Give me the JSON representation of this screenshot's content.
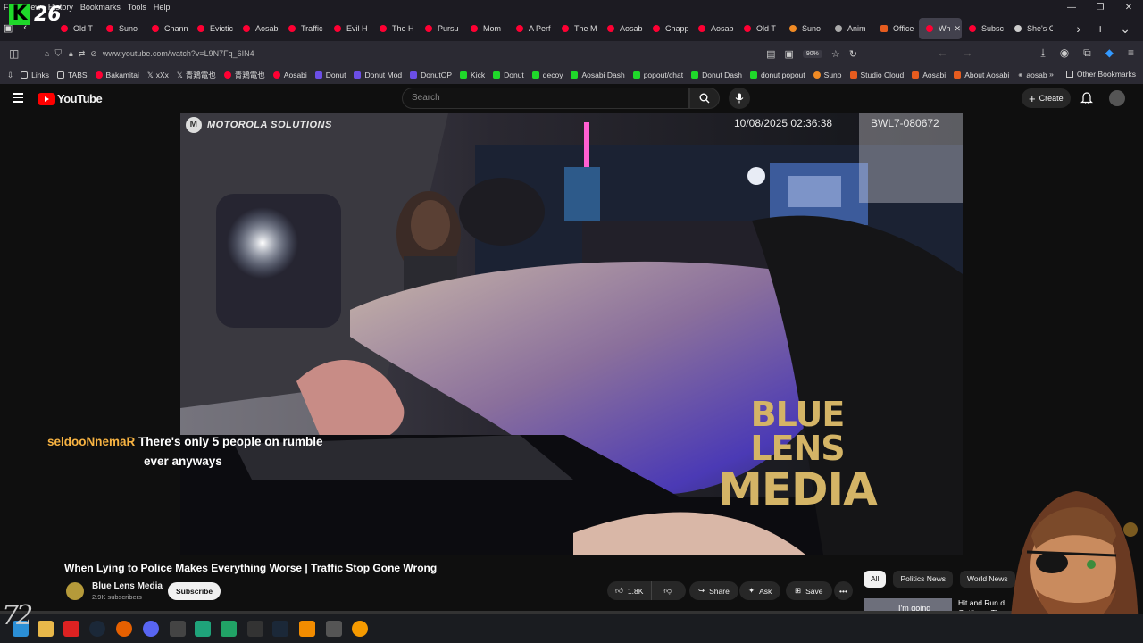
{
  "browser": {
    "menu": [
      "File",
      "View",
      "History",
      "Bookmarks",
      "Tools",
      "Help"
    ],
    "overlay_logo_number": "26",
    "tabs": [
      {
        "label": "Old T"
      },
      {
        "label": "Suno"
      },
      {
        "label": "Chann"
      },
      {
        "label": "Evictic"
      },
      {
        "label": "Aosab"
      },
      {
        "label": "Traffic"
      },
      {
        "label": "Evil H"
      },
      {
        "label": "The H"
      },
      {
        "label": "Pursu"
      },
      {
        "label": "Mom"
      },
      {
        "label": "A Perf"
      },
      {
        "label": "The M"
      },
      {
        "label": "Aosab"
      },
      {
        "label": "Chapp"
      },
      {
        "label": "Aosab"
      },
      {
        "label": "Old T"
      },
      {
        "label": "Suno"
      },
      {
        "label": "Anim"
      },
      {
        "label": "Office"
      },
      {
        "label": "Wh",
        "active": true
      },
      {
        "label": "Subsc"
      },
      {
        "label": "She's C"
      }
    ],
    "url": "www.youtube.com/watch?v=L9N7Fq_6IN4",
    "zoom": "90%",
    "bookmarks": [
      "Links",
      "TABS",
      "Bakamitai",
      "xXx",
      "青鶏電也",
      "青鶏電也",
      "Aosabi",
      "Donut",
      "Donut Mod",
      "DonutOP",
      "Kick",
      "Donut",
      "decoy",
      "Aosabi Dash",
      "popout/chat",
      "Donut Dash",
      "donut popout",
      "Suno",
      "Studio Cloud",
      "Aosabi",
      "About Aosabi",
      "aosab"
    ],
    "other_bookmarks": "Other Bookmarks"
  },
  "youtube": {
    "logo_text": "YouTube",
    "search_placeholder": "Search",
    "create_label": "Create",
    "video": {
      "camera_brand": "MOTOROLA SOLUTIONS",
      "timestamp": "10/08/2025 02:36:38",
      "device_id": "BWL7-080672",
      "watermark_line1": "BLUE LENS",
      "watermark_line2": "MEDIA"
    },
    "title": "When Lying to Police Makes Everything Worse | Traffic Stop Gone Wrong",
    "channel": {
      "name": "Blue Lens Media",
      "subscribers": "2.9K subscribers"
    },
    "subscribe_label": "Subscribe",
    "likes": "1.8K",
    "actions": {
      "share": "Share",
      "ask": "Ask",
      "save": "Save"
    },
    "chips": [
      "All",
      "Politics News",
      "World News"
    ],
    "recommendation": {
      "thumb_text": "I'm going",
      "title": "Hit and Run d Getting a Tic"
    }
  },
  "chat_overlay": {
    "username": "seldooNnemaR",
    "message_line1": "There's only 5 people on rumble",
    "message_line2": "ever anyways"
  },
  "taskbar": {
    "corner_text": "72"
  },
  "colors": {
    "youtube_red": "#ff0000",
    "chat_user": "#f7b342",
    "watermark": "#d4b466",
    "background": "#0f0f0f"
  }
}
